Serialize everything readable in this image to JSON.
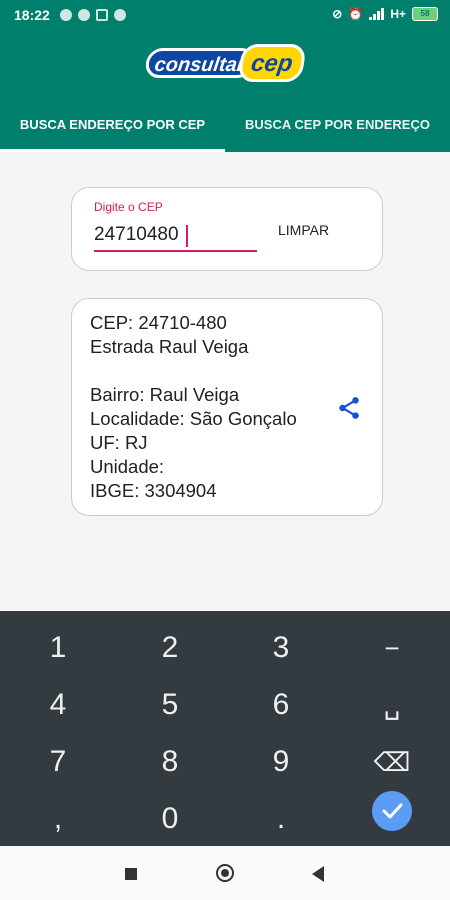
{
  "status_bar": {
    "time": "18:22",
    "network": "H+",
    "battery": "58"
  },
  "header": {
    "logo_text_1": "consultar",
    "logo_text_2": "cep"
  },
  "tabs": [
    {
      "label": "BUSCA ENDEREÇO POR CEP",
      "selected": true
    },
    {
      "label": "BUSCA CEP POR ENDEREÇO",
      "selected": false
    }
  ],
  "search": {
    "label": "Digite o CEP",
    "value": "24710480",
    "clear_label": "LIMPAR"
  },
  "result": {
    "lines": [
      "CEP: 24710-480",
      "Estrada Raul Veiga",
      "",
      "Bairro: Raul Veiga",
      "Localidade: São Gonçalo",
      "UF: RJ",
      "Unidade:",
      "IBGE: 3304904"
    ],
    "share_icon": "share-icon"
  },
  "keyboard": {
    "keys": [
      "1",
      "2",
      "3",
      "−",
      "4",
      "5",
      "6",
      "␣",
      "7",
      "8",
      "9",
      "⌫",
      ",",
      "0",
      "."
    ]
  },
  "colors": {
    "primary": "#00806c",
    "accent": "#d81b60",
    "keyboard_bg": "#333a40",
    "done_button": "#5b9cf4"
  }
}
